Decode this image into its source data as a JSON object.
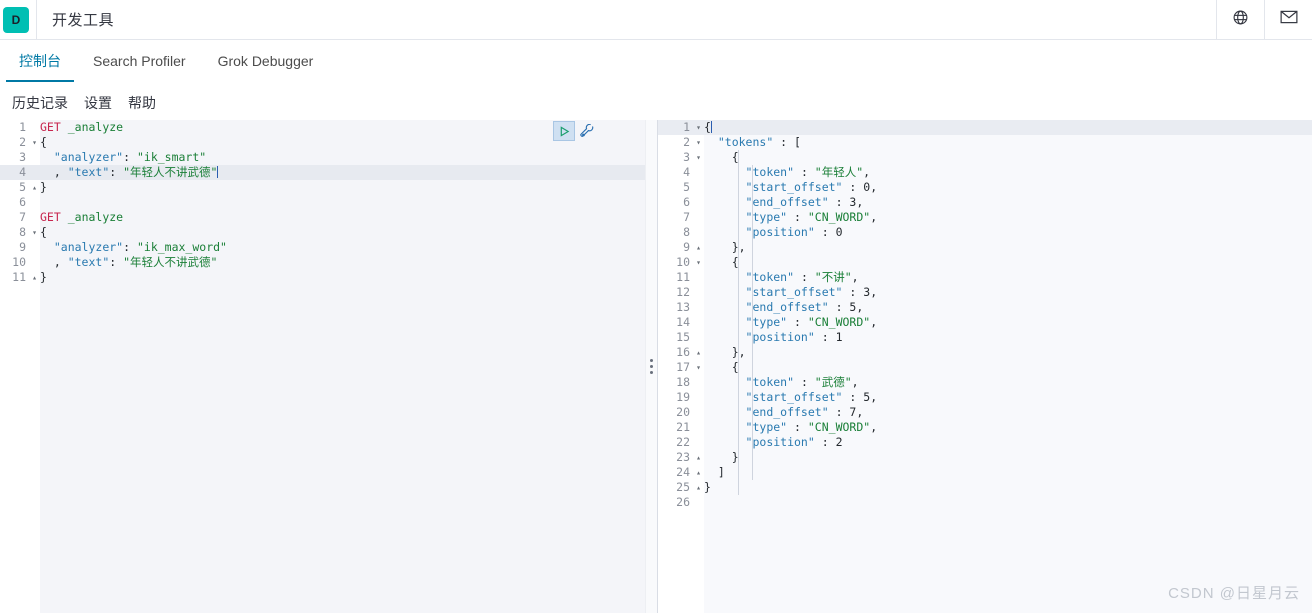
{
  "header": {
    "logo_letter": "D",
    "app_title": "开发工具",
    "icons": [
      {
        "name": "globe-icon",
        "label": "globe"
      },
      {
        "name": "mail-icon",
        "label": "mail"
      }
    ]
  },
  "tabs": [
    {
      "label": "控制台",
      "active": true
    },
    {
      "label": "Search Profiler",
      "active": false
    },
    {
      "label": "Grok Debugger",
      "active": false
    }
  ],
  "subnav": [
    {
      "label": "历史记录"
    },
    {
      "label": "设置"
    },
    {
      "label": "帮助"
    }
  ],
  "editor_actions": {
    "play_label": "发送请求",
    "wrench_label": "选项"
  },
  "request_editor": {
    "active_line": 4,
    "lines": [
      {
        "n": 1,
        "fold": "",
        "tokens": [
          {
            "t": "GET",
            "c": "k-method"
          },
          {
            "t": " ",
            "c": "k-punct"
          },
          {
            "t": "_analyze",
            "c": "k-path"
          }
        ]
      },
      {
        "n": 2,
        "fold": "▾",
        "tokens": [
          {
            "t": "{",
            "c": "k-brace"
          }
        ]
      },
      {
        "n": 3,
        "fold": "",
        "tokens": [
          {
            "t": "  ",
            "c": "k-punct"
          },
          {
            "t": "\"analyzer\"",
            "c": "k-key"
          },
          {
            "t": ": ",
            "c": "k-punct"
          },
          {
            "t": "\"ik_smart\"",
            "c": "k-str"
          }
        ]
      },
      {
        "n": 4,
        "fold": "",
        "tokens": [
          {
            "t": "  , ",
            "c": "k-punct"
          },
          {
            "t": "\"text\"",
            "c": "k-key"
          },
          {
            "t": ": ",
            "c": "k-punct"
          },
          {
            "t": "\"年轻人不讲武德\"",
            "c": "k-str"
          }
        ],
        "caret": true
      },
      {
        "n": 5,
        "fold": "▴",
        "tokens": [
          {
            "t": "}",
            "c": "k-brace"
          }
        ]
      },
      {
        "n": 6,
        "fold": "",
        "tokens": []
      },
      {
        "n": 7,
        "fold": "",
        "tokens": [
          {
            "t": "GET",
            "c": "k-method"
          },
          {
            "t": " ",
            "c": "k-punct"
          },
          {
            "t": "_analyze",
            "c": "k-path"
          }
        ]
      },
      {
        "n": 8,
        "fold": "▾",
        "tokens": [
          {
            "t": "{",
            "c": "k-brace"
          }
        ]
      },
      {
        "n": 9,
        "fold": "",
        "tokens": [
          {
            "t": "  ",
            "c": "k-punct"
          },
          {
            "t": "\"analyzer\"",
            "c": "k-key"
          },
          {
            "t": ": ",
            "c": "k-punct"
          },
          {
            "t": "\"ik_max_word\"",
            "c": "k-str"
          }
        ]
      },
      {
        "n": 10,
        "fold": "",
        "tokens": [
          {
            "t": "  , ",
            "c": "k-punct"
          },
          {
            "t": "\"text\"",
            "c": "k-key"
          },
          {
            "t": ": ",
            "c": "k-punct"
          },
          {
            "t": "\"年轻人不讲武德\"",
            "c": "k-str"
          }
        ]
      },
      {
        "n": 11,
        "fold": "▴",
        "tokens": [
          {
            "t": "}",
            "c": "k-brace"
          }
        ]
      }
    ]
  },
  "response_editor": {
    "active_line": 1,
    "lines": [
      {
        "n": 1,
        "fold": "▾",
        "tokens": [
          {
            "t": "{",
            "c": "k-brace"
          }
        ],
        "caret": true
      },
      {
        "n": 2,
        "fold": "▾",
        "tokens": [
          {
            "t": "  ",
            "c": "k-punct"
          },
          {
            "t": "\"tokens\"",
            "c": "k-key"
          },
          {
            "t": " : ",
            "c": "k-punct"
          },
          {
            "t": "[",
            "c": "k-brace"
          }
        ]
      },
      {
        "n": 3,
        "fold": "▾",
        "tokens": [
          {
            "t": "    ",
            "c": "k-punct"
          },
          {
            "t": "{",
            "c": "k-brace"
          }
        ]
      },
      {
        "n": 4,
        "fold": "",
        "tokens": [
          {
            "t": "      ",
            "c": "k-punct"
          },
          {
            "t": "\"token\"",
            "c": "k-key"
          },
          {
            "t": " : ",
            "c": "k-punct"
          },
          {
            "t": "\"年轻人\"",
            "c": "k-str"
          },
          {
            "t": ",",
            "c": "k-punct"
          }
        ]
      },
      {
        "n": 5,
        "fold": "",
        "tokens": [
          {
            "t": "      ",
            "c": "k-punct"
          },
          {
            "t": "\"start_offset\"",
            "c": "k-key"
          },
          {
            "t": " : ",
            "c": "k-punct"
          },
          {
            "t": "0",
            "c": "k-num"
          },
          {
            "t": ",",
            "c": "k-punct"
          }
        ]
      },
      {
        "n": 6,
        "fold": "",
        "tokens": [
          {
            "t": "      ",
            "c": "k-punct"
          },
          {
            "t": "\"end_offset\"",
            "c": "k-key"
          },
          {
            "t": " : ",
            "c": "k-punct"
          },
          {
            "t": "3",
            "c": "k-num"
          },
          {
            "t": ",",
            "c": "k-punct"
          }
        ]
      },
      {
        "n": 7,
        "fold": "",
        "tokens": [
          {
            "t": "      ",
            "c": "k-punct"
          },
          {
            "t": "\"type\"",
            "c": "k-key"
          },
          {
            "t": " : ",
            "c": "k-punct"
          },
          {
            "t": "\"CN_WORD\"",
            "c": "k-str"
          },
          {
            "t": ",",
            "c": "k-punct"
          }
        ]
      },
      {
        "n": 8,
        "fold": "",
        "tokens": [
          {
            "t": "      ",
            "c": "k-punct"
          },
          {
            "t": "\"position\"",
            "c": "k-key"
          },
          {
            "t": " : ",
            "c": "k-punct"
          },
          {
            "t": "0",
            "c": "k-num"
          }
        ]
      },
      {
        "n": 9,
        "fold": "▴",
        "tokens": [
          {
            "t": "    ",
            "c": "k-punct"
          },
          {
            "t": "},",
            "c": "k-brace"
          }
        ]
      },
      {
        "n": 10,
        "fold": "▾",
        "tokens": [
          {
            "t": "    ",
            "c": "k-punct"
          },
          {
            "t": "{",
            "c": "k-brace"
          }
        ]
      },
      {
        "n": 11,
        "fold": "",
        "tokens": [
          {
            "t": "      ",
            "c": "k-punct"
          },
          {
            "t": "\"token\"",
            "c": "k-key"
          },
          {
            "t": " : ",
            "c": "k-punct"
          },
          {
            "t": "\"不讲\"",
            "c": "k-str"
          },
          {
            "t": ",",
            "c": "k-punct"
          }
        ]
      },
      {
        "n": 12,
        "fold": "",
        "tokens": [
          {
            "t": "      ",
            "c": "k-punct"
          },
          {
            "t": "\"start_offset\"",
            "c": "k-key"
          },
          {
            "t": " : ",
            "c": "k-punct"
          },
          {
            "t": "3",
            "c": "k-num"
          },
          {
            "t": ",",
            "c": "k-punct"
          }
        ]
      },
      {
        "n": 13,
        "fold": "",
        "tokens": [
          {
            "t": "      ",
            "c": "k-punct"
          },
          {
            "t": "\"end_offset\"",
            "c": "k-key"
          },
          {
            "t": " : ",
            "c": "k-punct"
          },
          {
            "t": "5",
            "c": "k-num"
          },
          {
            "t": ",",
            "c": "k-punct"
          }
        ]
      },
      {
        "n": 14,
        "fold": "",
        "tokens": [
          {
            "t": "      ",
            "c": "k-punct"
          },
          {
            "t": "\"type\"",
            "c": "k-key"
          },
          {
            "t": " : ",
            "c": "k-punct"
          },
          {
            "t": "\"CN_WORD\"",
            "c": "k-str"
          },
          {
            "t": ",",
            "c": "k-punct"
          }
        ]
      },
      {
        "n": 15,
        "fold": "",
        "tokens": [
          {
            "t": "      ",
            "c": "k-punct"
          },
          {
            "t": "\"position\"",
            "c": "k-key"
          },
          {
            "t": " : ",
            "c": "k-punct"
          },
          {
            "t": "1",
            "c": "k-num"
          }
        ]
      },
      {
        "n": 16,
        "fold": "▴",
        "tokens": [
          {
            "t": "    ",
            "c": "k-punct"
          },
          {
            "t": "},",
            "c": "k-brace"
          }
        ]
      },
      {
        "n": 17,
        "fold": "▾",
        "tokens": [
          {
            "t": "    ",
            "c": "k-punct"
          },
          {
            "t": "{",
            "c": "k-brace"
          }
        ]
      },
      {
        "n": 18,
        "fold": "",
        "tokens": [
          {
            "t": "      ",
            "c": "k-punct"
          },
          {
            "t": "\"token\"",
            "c": "k-key"
          },
          {
            "t": " : ",
            "c": "k-punct"
          },
          {
            "t": "\"武德\"",
            "c": "k-str"
          },
          {
            "t": ",",
            "c": "k-punct"
          }
        ]
      },
      {
        "n": 19,
        "fold": "",
        "tokens": [
          {
            "t": "      ",
            "c": "k-punct"
          },
          {
            "t": "\"start_offset\"",
            "c": "k-key"
          },
          {
            "t": " : ",
            "c": "k-punct"
          },
          {
            "t": "5",
            "c": "k-num"
          },
          {
            "t": ",",
            "c": "k-punct"
          }
        ]
      },
      {
        "n": 20,
        "fold": "",
        "tokens": [
          {
            "t": "      ",
            "c": "k-punct"
          },
          {
            "t": "\"end_offset\"",
            "c": "k-key"
          },
          {
            "t": " : ",
            "c": "k-punct"
          },
          {
            "t": "7",
            "c": "k-num"
          },
          {
            "t": ",",
            "c": "k-punct"
          }
        ]
      },
      {
        "n": 21,
        "fold": "",
        "tokens": [
          {
            "t": "      ",
            "c": "k-punct"
          },
          {
            "t": "\"type\"",
            "c": "k-key"
          },
          {
            "t": " : ",
            "c": "k-punct"
          },
          {
            "t": "\"CN_WORD\"",
            "c": "k-str"
          },
          {
            "t": ",",
            "c": "k-punct"
          }
        ]
      },
      {
        "n": 22,
        "fold": "",
        "tokens": [
          {
            "t": "      ",
            "c": "k-punct"
          },
          {
            "t": "\"position\"",
            "c": "k-key"
          },
          {
            "t": " : ",
            "c": "k-punct"
          },
          {
            "t": "2",
            "c": "k-num"
          }
        ]
      },
      {
        "n": 23,
        "fold": "▴",
        "tokens": [
          {
            "t": "    ",
            "c": "k-punct"
          },
          {
            "t": "}",
            "c": "k-brace"
          }
        ]
      },
      {
        "n": 24,
        "fold": "▴",
        "tokens": [
          {
            "t": "  ",
            "c": "k-punct"
          },
          {
            "t": "]",
            "c": "k-brace"
          }
        ]
      },
      {
        "n": 25,
        "fold": "▴",
        "tokens": [
          {
            "t": "}",
            "c": "k-brace"
          }
        ]
      },
      {
        "n": 26,
        "fold": "",
        "tokens": []
      }
    ]
  },
  "watermark": "CSDN @日星月云",
  "colors": {
    "brand_teal": "#00bfb3",
    "accent_blue": "#0079a5",
    "key_blue": "#2a7ab0",
    "string_green": "#1a7f37",
    "method_red": "#c7254e"
  }
}
